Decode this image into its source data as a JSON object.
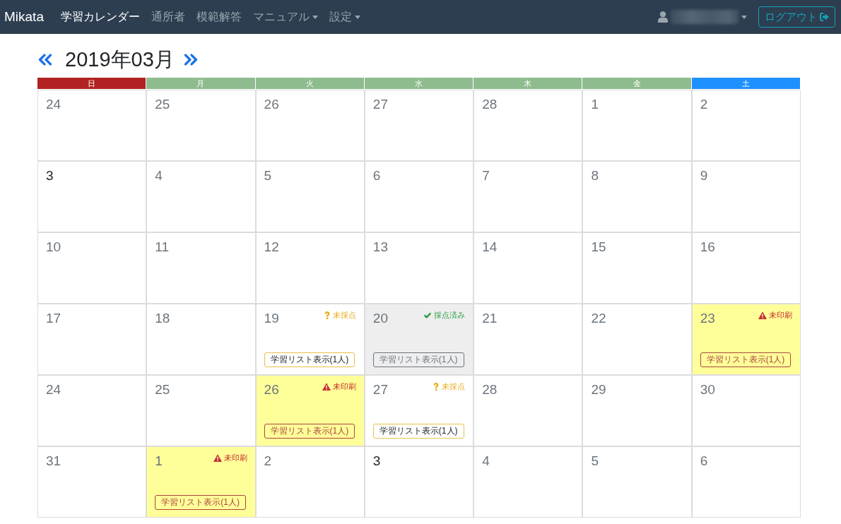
{
  "navbar": {
    "brand": "Mikata",
    "items": [
      {
        "label": "学習カレンダー",
        "selected": true,
        "dropdown": false
      },
      {
        "label": "通所者",
        "selected": false,
        "dropdown": false
      },
      {
        "label": "模範解答",
        "selected": false,
        "dropdown": false
      },
      {
        "label": "マニュアル",
        "selected": false,
        "dropdown": true
      },
      {
        "label": "設定",
        "selected": false,
        "dropdown": true
      }
    ],
    "logout": "ログアウト"
  },
  "calendar": {
    "title": "2019年03月",
    "weekdays": [
      {
        "label": "日",
        "color": "#b22222"
      },
      {
        "label": "月",
        "color": "#8fbc8f"
      },
      {
        "label": "火",
        "color": "#8fbc8f"
      },
      {
        "label": "水",
        "color": "#8fbc8f"
      },
      {
        "label": "木",
        "color": "#8fbc8f"
      },
      {
        "label": "金",
        "color": "#8fbc8f"
      },
      {
        "label": "土",
        "color": "#1e90ff"
      }
    ],
    "weeks": [
      {
        "days": [
          {
            "number": "24",
            "emphasized": false
          },
          {
            "number": "25",
            "emphasized": false
          },
          {
            "number": "26",
            "emphasized": false
          },
          {
            "number": "27",
            "emphasized": false
          },
          {
            "number": "28",
            "emphasized": false
          },
          {
            "number": "1",
            "emphasized": false
          },
          {
            "number": "2",
            "emphasized": false
          }
        ]
      },
      {
        "days": [
          {
            "number": "3",
            "emphasized": true
          },
          {
            "number": "4",
            "emphasized": false
          },
          {
            "number": "5",
            "emphasized": false
          },
          {
            "number": "6",
            "emphasized": false
          },
          {
            "number": "7",
            "emphasized": false
          },
          {
            "number": "8",
            "emphasized": false
          },
          {
            "number": "9",
            "emphasized": false
          }
        ]
      },
      {
        "days": [
          {
            "number": "10",
            "emphasized": false
          },
          {
            "number": "11",
            "emphasized": false
          },
          {
            "number": "12",
            "emphasized": false
          },
          {
            "number": "13",
            "emphasized": false
          },
          {
            "number": "14",
            "emphasized": false
          },
          {
            "number": "15",
            "emphasized": false
          },
          {
            "number": "16",
            "emphasized": false
          }
        ]
      },
      {
        "days": [
          {
            "number": "17",
            "emphasized": false
          },
          {
            "number": "18",
            "emphasized": false
          },
          {
            "number": "19",
            "emphasized": false,
            "status": {
              "kind": "ungraded",
              "label": "未採点"
            },
            "list_button": "学習リスト表示(1人)"
          },
          {
            "number": "20",
            "emphasized": false,
            "status": {
              "kind": "graded",
              "label": "採点済み"
            },
            "list_button": "学習リスト表示(1人)"
          },
          {
            "number": "21",
            "emphasized": false
          },
          {
            "number": "22",
            "emphasized": false
          },
          {
            "number": "23",
            "emphasized": false,
            "status": {
              "kind": "unprinted",
              "label": "未印刷"
            },
            "list_button": "学習リスト表示(1人)"
          }
        ]
      },
      {
        "days": [
          {
            "number": "24",
            "emphasized": false
          },
          {
            "number": "25",
            "emphasized": false
          },
          {
            "number": "26",
            "emphasized": false,
            "status": {
              "kind": "unprinted",
              "label": "未印刷"
            },
            "list_button": "学習リスト表示(1人)"
          },
          {
            "number": "27",
            "emphasized": false,
            "status": {
              "kind": "ungraded",
              "label": "未採点"
            },
            "list_button": "学習リスト表示(1人)"
          },
          {
            "number": "28",
            "emphasized": false
          },
          {
            "number": "29",
            "emphasized": false
          },
          {
            "number": "30",
            "emphasized": false
          }
        ]
      },
      {
        "days": [
          {
            "number": "31",
            "emphasized": false
          },
          {
            "number": "1",
            "emphasized": false,
            "status": {
              "kind": "unprinted",
              "label": "未印刷"
            },
            "list_button": "学習リスト表示(1人)"
          },
          {
            "number": "2",
            "emphasized": false
          },
          {
            "number": "3",
            "emphasized": true
          },
          {
            "number": "4",
            "emphasized": false
          },
          {
            "number": "5",
            "emphasized": false
          },
          {
            "number": "6",
            "emphasized": false
          }
        ]
      }
    ]
  }
}
